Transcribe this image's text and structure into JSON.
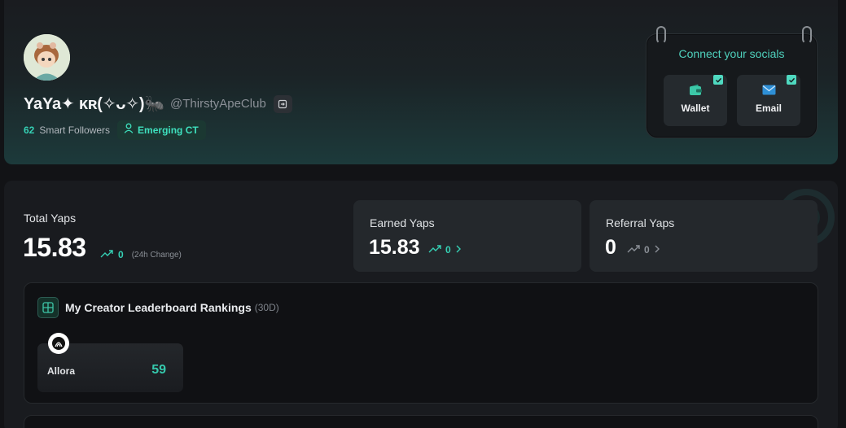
{
  "profile": {
    "display_name": "YaYa✦ ᴋʀ(✧ᴗ✧)🐜",
    "handle": "@ThirstyApeClub",
    "smart_followers_count": "62",
    "smart_followers_label": "Smart Followers",
    "badge_label": "Emerging CT"
  },
  "socials": {
    "title": "Connect your socials",
    "wallet_label": "Wallet",
    "email_label": "Email"
  },
  "yaps": {
    "total_label": "Total Yaps",
    "total_value": "15.83",
    "change_value": "0",
    "change_note": "(24h Change)",
    "earned_label": "Earned Yaps",
    "earned_value": "15.83",
    "earned_change": "0",
    "referral_label": "Referral Yaps",
    "referral_value": "0",
    "referral_change": "0"
  },
  "rankings": {
    "title": "My Creator Leaderboard Rankings",
    "period": "(30D)",
    "items": [
      {
        "name": "Allora",
        "score": "59"
      }
    ]
  },
  "colors": {
    "accent": "#35d0b4",
    "muted": "#8b9097",
    "background": "#121316"
  },
  "icons": [
    "avatar",
    "exit-icon",
    "person-icon",
    "wallet-icon",
    "mail-icon",
    "check-icon",
    "trend-up-icon",
    "chevron-right-icon",
    "layout-grid-icon",
    "allora-logo"
  ]
}
